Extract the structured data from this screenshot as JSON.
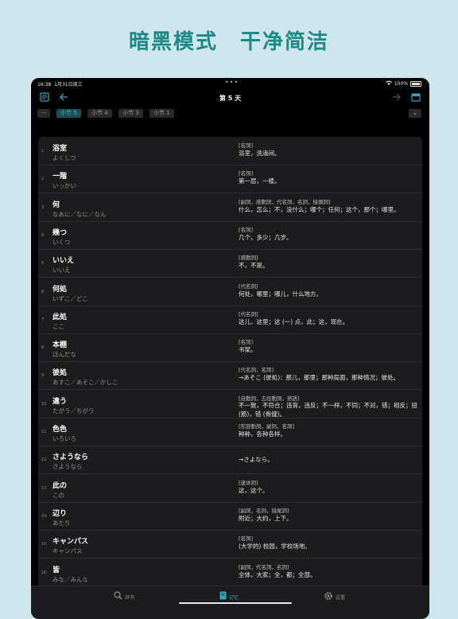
{
  "headline": "暗黑模式　干净简洁",
  "status": {
    "time": "16:38",
    "date": "1月31日周三",
    "dots": "•••",
    "battery": "100%"
  },
  "toolbar": {
    "title": "第 5 天"
  },
  "chips": {
    "more": "···",
    "items": [
      "小节 5",
      "小节 4",
      "小节 3",
      "小节 1"
    ],
    "dropdown": "⌄"
  },
  "entries": [
    {
      "n": "1",
      "word": "浴室",
      "kana": "よくしつ",
      "pos": "[名詞]",
      "meaning": "浴室，洗澡间。"
    },
    {
      "n": "2",
      "word": "一階",
      "kana": "いっかい",
      "pos": "[名詞]",
      "meaning": "第一层，一楼。"
    },
    {
      "n": "3",
      "word": "何",
      "kana": "なあに／なに／なん",
      "pos": "[副詞，感動詞，代名詞，名詞，接頭詞]",
      "meaning": "什么，怎么；不，没什么；哪个；任何；这个，那个；哪里。"
    },
    {
      "n": "4",
      "word": "幾つ",
      "kana": "いくつ",
      "pos": "[名詞]",
      "meaning": "几个，多少；几岁。"
    },
    {
      "n": "5",
      "word": "いいえ",
      "kana": "いいえ",
      "pos": "[感動詞]",
      "meaning": "不，不是。"
    },
    {
      "n": "6",
      "word": "何処",
      "kana": "いずこ／どこ",
      "pos": "[代名詞]",
      "meaning": "何处，哪里；哪儿，什么地方。"
    },
    {
      "n": "7",
      "word": "此処",
      "kana": "ここ",
      "pos": "[代名詞]",
      "meaning": "这儿，这里；这 (一) 点，此；这，现在。"
    },
    {
      "n": "8",
      "word": "本棚",
      "kana": "ほんだな",
      "pos": "[名詞]",
      "meaning": "书架。"
    },
    {
      "n": "9",
      "word": "彼処",
      "kana": "あすこ／あそこ／かしこ",
      "pos": "[代名詞，名詞]",
      "meaning": "→あそこ (彼処)：那儿，那里；那种局面，那种情况；彼处。"
    },
    {
      "n": "10",
      "word": "違う",
      "kana": "たがう／ちがう",
      "pos": "[自動詞，五段動詞，熟語]",
      "meaning": "不一致，不符合；违背，违反；不一样，不同；不对，错；相反；扭 (筋)，错 (骨缝)。"
    },
    {
      "n": "11",
      "word": "色色",
      "kana": "いろいろ",
      "pos": "[形容動詞，副詞，名詞]",
      "meaning": "种种，各种各样。"
    },
    {
      "n": "12",
      "word": "さようなら",
      "kana": "さようなら",
      "pos": "",
      "meaning": "→さよなら。"
    },
    {
      "n": "13",
      "word": "此の",
      "kana": "この",
      "pos": "[連体詞]",
      "meaning": "这，这个。"
    },
    {
      "n": "14",
      "word": "辺り",
      "kana": "あたり",
      "pos": "[副詞，名詞，接尾詞]",
      "meaning": "附近；大约，上下。"
    },
    {
      "n": "15",
      "word": "キャンパス",
      "kana": "キャンパス",
      "pos": "[名詞]",
      "meaning": "(大学的) 校园，学校场地。"
    },
    {
      "n": "16",
      "word": "皆",
      "kana": "みな／みんな",
      "pos": "[副詞，代名詞，名詞]",
      "meaning": "全体，大家；全，都；全部。"
    }
  ],
  "tabs": [
    {
      "label": "辞书",
      "icon": "search-icon"
    },
    {
      "label": "记忆",
      "icon": "book-icon"
    },
    {
      "label": "设置",
      "icon": "gear-icon"
    }
  ]
}
